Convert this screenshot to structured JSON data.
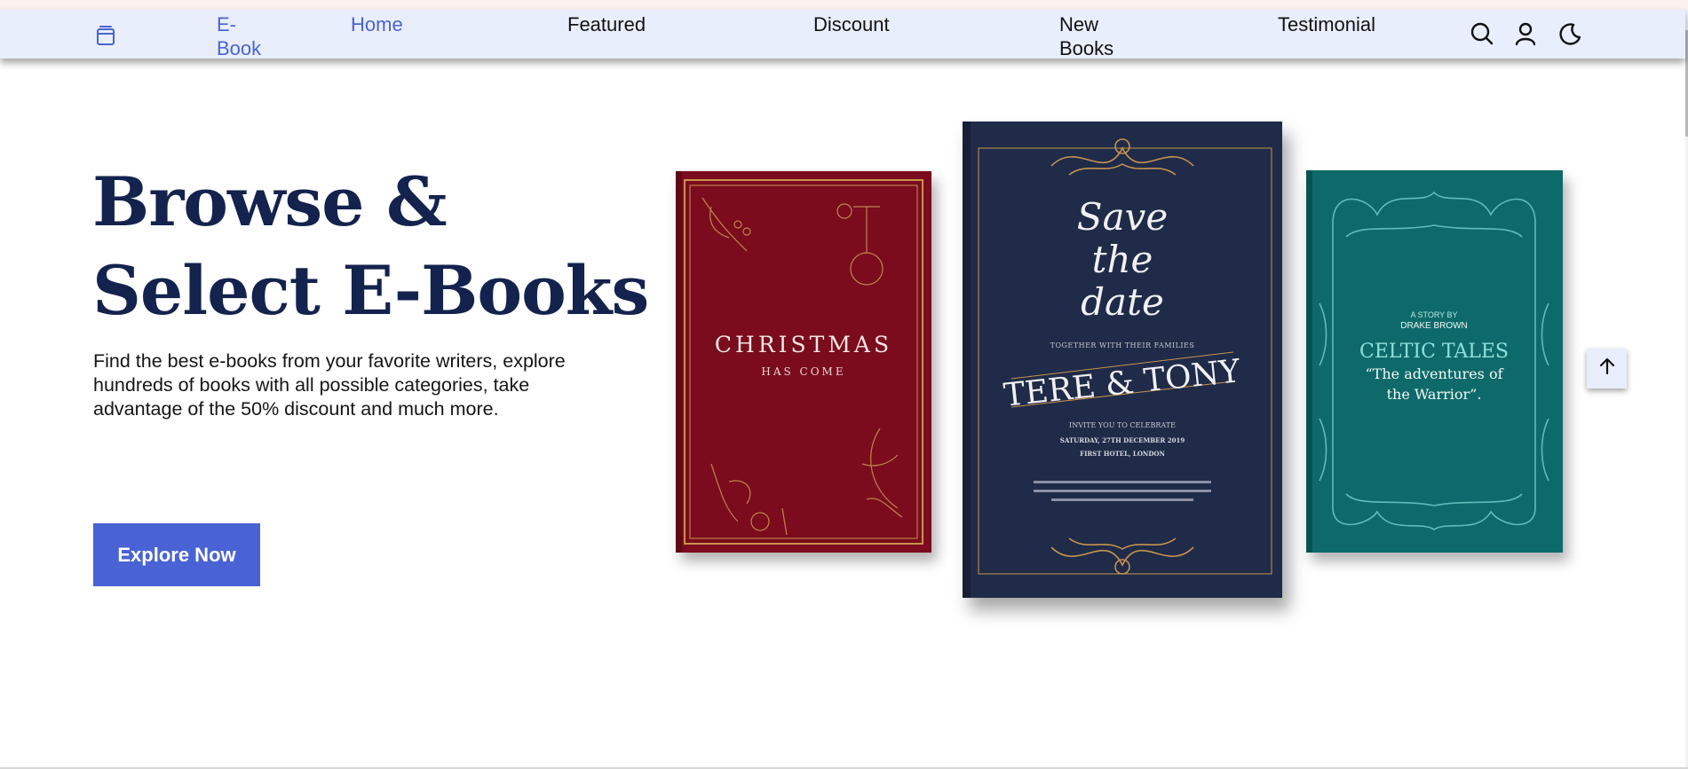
{
  "header": {
    "logo_text": "E-Book",
    "nav": [
      {
        "label": "Home",
        "active": true
      },
      {
        "label": "Featured"
      },
      {
        "label": "Discount"
      },
      {
        "label": "New Books"
      },
      {
        "label": "Testimonial"
      }
    ],
    "icons": [
      "book-icon",
      "search-icon",
      "user-icon",
      "moon-icon"
    ]
  },
  "hero": {
    "title_line1": "Browse &",
    "title_line2": "Select E-Books",
    "description": "Find the best e-books from your favorite writers, explore hundreds of books with all possible categories, take advantage of the 50% discount and much more.",
    "button": "Explore Now"
  },
  "books": [
    {
      "title": "CHRISTMAS",
      "subtitle": "HAS COME"
    },
    {
      "script_line1": "Save",
      "script_line2": "the",
      "script_line3": "date",
      "pre": "TOGETHER WITH THEIR FAMILIES",
      "names": "TERE & TONY",
      "invite": "INVITE YOU TO CELEBRATE",
      "date": "SATURDAY, 27TH DECEMBER 2019",
      "venue": "FIRST HOTEL, LONDON"
    },
    {
      "kicker": "A STORY BY",
      "author": "DRAKE BROWN",
      "title": "CELTIC TALES",
      "tagline1": "“The adventures of",
      "tagline2": "the Warrior”."
    }
  ],
  "colors": {
    "accent": "#4a63d4",
    "header_bg": "#e9eefc",
    "title": "#14224e",
    "book_red": "#7a0c1e",
    "book_navy": "#1f2b48",
    "book_teal": "#0e6a6a",
    "gold": "#c8934e"
  }
}
